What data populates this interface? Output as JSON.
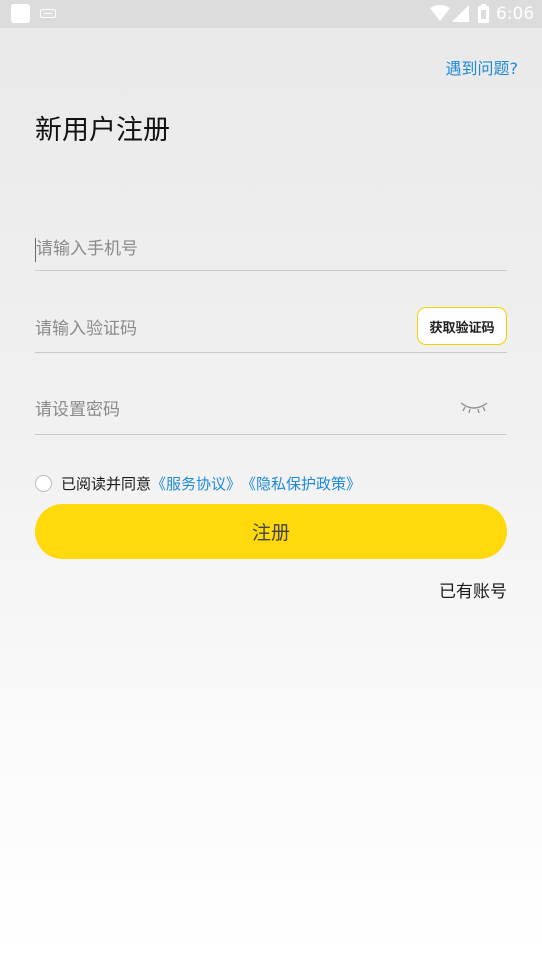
{
  "status_bar": {
    "time": "6:06",
    "icons": [
      "app-notification-icon",
      "keyboard-icon",
      "wifi-icon",
      "signal-icon",
      "battery-icon"
    ]
  },
  "header": {
    "help_link": "遇到问题?",
    "title": "新用户注册"
  },
  "form": {
    "phone_placeholder": "请输入手机号",
    "code_placeholder": "请输入验证码",
    "get_code_label": "获取验证码",
    "password_placeholder": "请设置密码",
    "password_toggle_icon": "eye-closed-icon"
  },
  "agreement": {
    "prefix": "已阅读并同意",
    "service_link": "《服务协议》",
    "privacy_link": "《隐私保护政策》",
    "checked": false
  },
  "actions": {
    "register_label": "注册",
    "login_link": "已有账号"
  },
  "colors": {
    "accent_yellow": "#ffd90b",
    "link_blue": "#1f8ad6",
    "status_bar": "#dcdcdc"
  }
}
